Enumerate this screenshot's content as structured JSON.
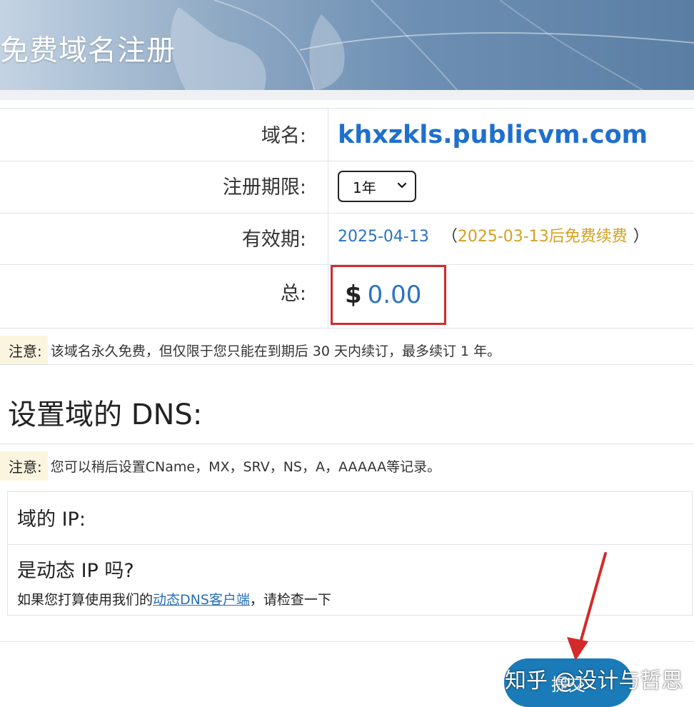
{
  "header": {
    "title": "免费域名注册"
  },
  "form": {
    "domain_label": "域名:",
    "domain_value": "khxzkls.publicvm.com",
    "period_label": "注册期限:",
    "period_selected": "1年",
    "expiry_label": "有效期:",
    "expiry_date": "2025-04-13",
    "renew_open": "（",
    "renew_note": "2025-03-13后免费续费",
    "renew_close": "）",
    "total_label": "总:",
    "total_currency": "$",
    "total_amount": "0.00"
  },
  "note1": {
    "tag": "注意:",
    "text": "该域名永久免费，但仅限于您只能在到期后 30 天内续订，最多续订 1 年。"
  },
  "dns": {
    "title": "设置域的 DNS:",
    "note_tag": "注意:",
    "note_text": "您可以稍后设置CName，MX，SRV，NS，A，AAAAA等记录。",
    "ip_label": "域的 IP:",
    "dynamic_label": "是动态 IP 吗?",
    "dynamic_prefix": "如果您打算使用我们的",
    "dynamic_link": "动态DNS客户端",
    "dynamic_suffix": "，请检查一下"
  },
  "submit": {
    "label": "提交"
  },
  "watermark": "知乎 @设计与哲思",
  "colors": {
    "accent_blue": "#1f6fce",
    "highlight_red": "#d42a2a",
    "renew_gold": "#d4a020",
    "button_blue": "#1a7bb8"
  }
}
